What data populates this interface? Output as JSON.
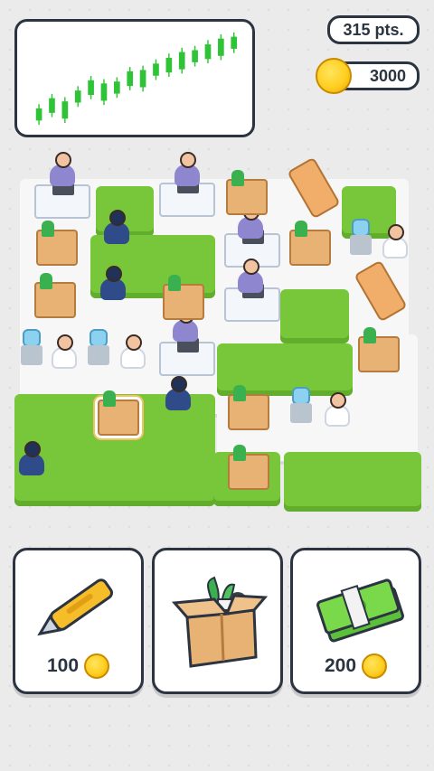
{
  "hud": {
    "points_label": "315 pts.",
    "coins_value": "3000"
  },
  "chart_data": {
    "type": "candlestick",
    "title": "",
    "xlabel": "",
    "ylabel": "",
    "values": [
      1,
      2,
      1.5,
      3,
      4,
      3.5,
      4,
      5,
      5,
      6,
      6.5,
      7,
      7.5,
      8,
      8.5,
      9
    ],
    "color": "#2fc437"
  },
  "shop": {
    "items": [
      {
        "name": "cutter",
        "price": "100"
      },
      {
        "name": "box",
        "price": ""
      },
      {
        "name": "cash",
        "price": "200"
      }
    ]
  },
  "colors": {
    "grass": "#78c63a",
    "outline": "#2b3440",
    "coin": "#ffcf22",
    "candle": "#2fc437"
  },
  "icons": [
    "coin-icon",
    "utility-knife-icon",
    "office-box-icon",
    "cash-stack-icon"
  ]
}
